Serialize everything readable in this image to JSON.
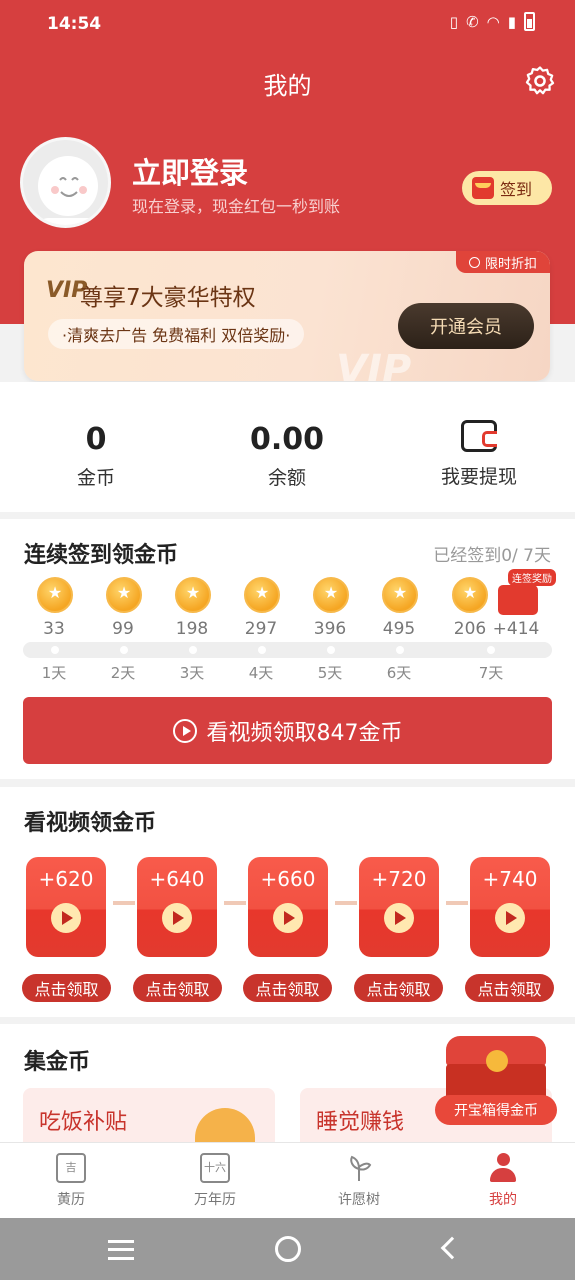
{
  "status": {
    "time": "14:54"
  },
  "header": {
    "title": "我的"
  },
  "profile": {
    "login_title": "立即登录",
    "login_sub": "现在登录，现金红包一秒到账",
    "signin_label": "签到"
  },
  "vip": {
    "tag": "限时折扣",
    "logo": "VIP",
    "headline": "尊享7大豪华特权",
    "perks": "·清爽去广告 免费福利 双倍奖励·",
    "button": "开通会员",
    "watermark": "VIP"
  },
  "stats": {
    "coins_value": "0",
    "coins_label": "金币",
    "balance_value": "0.00",
    "balance_label": "余额",
    "withdraw_label": "我要提现"
  },
  "checkin": {
    "title": "连续签到领金币",
    "progress": "已经签到0/ 7天",
    "bonus_tag": "连签奖励",
    "days": [
      {
        "coins": "33",
        "day": "1天"
      },
      {
        "coins": "99",
        "day": "2天"
      },
      {
        "coins": "198",
        "day": "3天"
      },
      {
        "coins": "297",
        "day": "4天"
      },
      {
        "coins": "396",
        "day": "5天"
      },
      {
        "coins": "495",
        "day": "6天"
      },
      {
        "coins": "206",
        "day": "7天"
      }
    ],
    "bonus": "+414",
    "watch_button": "看视频领取847金币"
  },
  "videos": {
    "title": "看视频领金币",
    "packets": [
      {
        "amount": "+620",
        "claim": "点击领取"
      },
      {
        "amount": "+640",
        "claim": "点击领取"
      },
      {
        "amount": "+660",
        "claim": "点击领取"
      },
      {
        "amount": "+720",
        "claim": "点击领取"
      },
      {
        "amount": "+740",
        "claim": "点击领取"
      }
    ]
  },
  "collect": {
    "title": "集金币",
    "card1": "吃饭补贴",
    "card2": "睡觉赚钱",
    "chest_button": "开宝箱得金币"
  },
  "tabs": [
    {
      "label": "黄历",
      "icon": "calendar-ji-icon"
    },
    {
      "label": "万年历",
      "icon": "calendar-16-icon"
    },
    {
      "label": "许愿树",
      "icon": "sprout-icon"
    },
    {
      "label": "我的",
      "icon": "user-icon"
    }
  ],
  "colors": {
    "brand": "#d63f3f",
    "gold": "#f5a623"
  }
}
